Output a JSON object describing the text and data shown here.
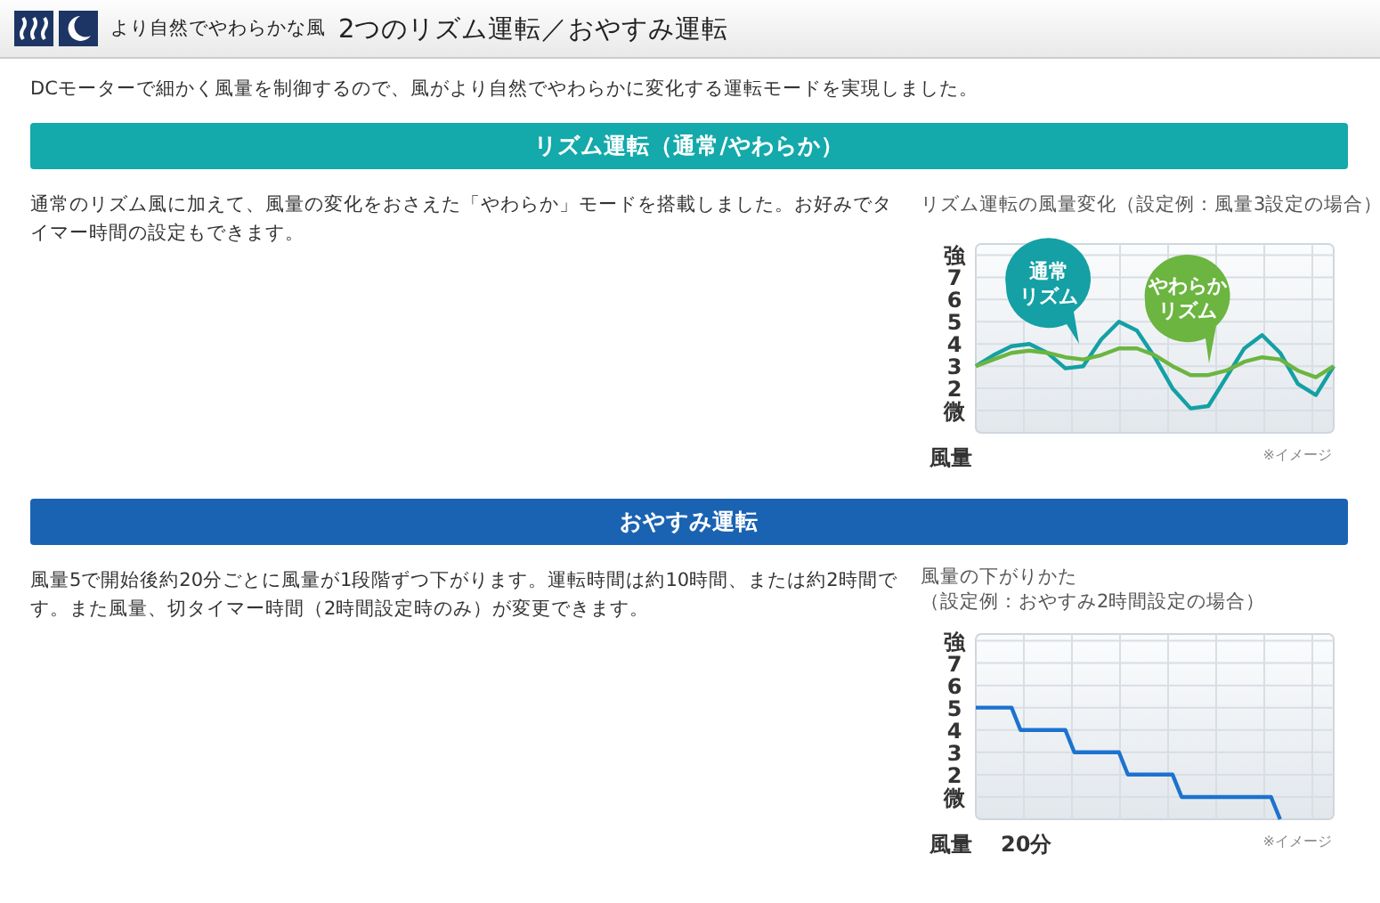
{
  "header": {
    "subtitle": "より自然でやわらかな風",
    "title": "2つのリズム運転／おやすみ運転"
  },
  "intro": "DCモーターで細かく風量を制御するので、風がより自然でやわらかに変化する運転モードを実現しました。",
  "sections": [
    {
      "heading": "リズム運転（通常/やわらか）",
      "color": "#14a9ab",
      "text": "通常のリズム風に加えて、風量の変化をおさえた「やわらか」モードを搭載しました。お好みでタイマー時間の設定もできます。",
      "chart": {
        "kind": "wave",
        "title_lines": [
          "リズム運転の風量変化（設定例：風量3設定の場合）"
        ],
        "bubbles": [
          {
            "label_lines": [
              "通常",
              "リズム"
            ]
          },
          {
            "label_lines": [
              "やわらか",
              "リズム"
            ]
          }
        ],
        "note": "※イメージ",
        "chart_data": {
          "type": "line",
          "grid": true,
          "ylabel": "風量",
          "categories": [
            null,
            null,
            null,
            null,
            null,
            null,
            null,
            null,
            null,
            null,
            null,
            null,
            null,
            null,
            null,
            null,
            null,
            null,
            null,
            null,
            null
          ],
          "ylim": [
            0,
            8.5
          ],
          "yticks": [
            {
              "value": 8,
              "label": "強"
            },
            {
              "value": 7,
              "label": "7"
            },
            {
              "value": 6,
              "label": "6"
            },
            {
              "value": 5,
              "label": "5"
            },
            {
              "value": 4,
              "label": "4"
            },
            {
              "value": 3,
              "label": "3"
            },
            {
              "value": 2,
              "label": "2"
            },
            {
              "value": 1,
              "label": "微"
            }
          ],
          "series": [
            {
              "color": "#14a0a4",
              "values": [
                3.0,
                3.5,
                3.9,
                4.0,
                3.6,
                2.9,
                3.0,
                4.2,
                5.0,
                4.6,
                3.4,
                2.0,
                1.1,
                1.2,
                2.5,
                3.8,
                4.4,
                3.6,
                2.2,
                1.7,
                3.0
              ]
            },
            {
              "color": "#6bb540",
              "values": [
                3.0,
                3.3,
                3.6,
                3.7,
                3.6,
                3.4,
                3.3,
                3.5,
                3.8,
                3.8,
                3.5,
                3.0,
                2.6,
                2.6,
                2.8,
                3.2,
                3.4,
                3.3,
                2.8,
                2.5,
                3.0
              ]
            }
          ]
        }
      }
    },
    {
      "heading": "おやすみ運転",
      "color": "#1a63b2",
      "text": "風量5で開始後約20分ごとに風量が1段階ずつ下がります。運転時間は約10時間、または約2時間です。また風量、切タイマー時間（2時間設定時のみ）が変更できます。",
      "chart": {
        "kind": "step",
        "title_lines": [
          "風量の下がりかた",
          "（設定例：おやすみ2時間設定の場合）"
        ],
        "note": "※イメージ",
        "chart_data": {
          "type": "line",
          "grid": true,
          "xlabel": "20分",
          "ylabel": "風量",
          "categories": [
            null,
            null,
            null,
            null,
            null,
            null,
            null,
            null,
            null,
            null,
            null,
            null,
            null,
            null,
            null,
            null,
            null,
            null,
            null,
            null,
            null,
            null,
            null,
            null,
            null,
            null,
            null,
            null,
            null,
            null,
            null,
            null,
            null,
            null,
            null,
            null,
            null,
            null,
            null,
            null,
            null
          ],
          "ylim": [
            0,
            8.3
          ],
          "yticks": [
            {
              "value": 8,
              "label": "強"
            },
            {
              "value": 7,
              "label": "7"
            },
            {
              "value": 6,
              "label": "6"
            },
            {
              "value": 5,
              "label": "5"
            },
            {
              "value": 4,
              "label": "4"
            },
            {
              "value": 3,
              "label": "3"
            },
            {
              "value": 2,
              "label": "2"
            },
            {
              "value": 1,
              "label": "微"
            }
          ],
          "series": [
            {
              "color": "#1c73cf",
              "values": [
                5,
                5,
                5,
                5,
                5,
                4,
                4,
                4,
                4,
                4,
                4,
                3,
                3,
                3,
                3,
                3,
                3,
                2,
                2,
                2,
                2,
                2,
                2,
                1,
                1,
                1,
                1,
                1,
                1,
                1,
                1,
                1,
                1,
                1,
                0,
                null,
                null,
                null,
                null,
                null,
                null
              ]
            }
          ]
        }
      }
    }
  ]
}
